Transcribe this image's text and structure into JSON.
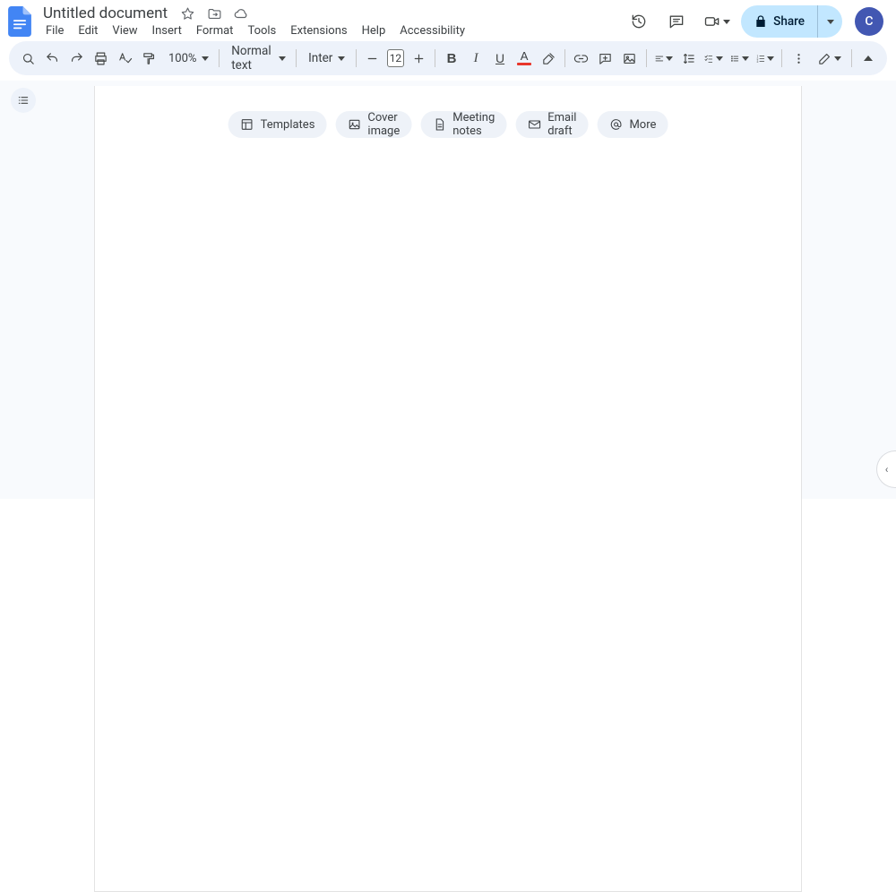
{
  "header": {
    "title": "Untitled document",
    "share_label": "Share",
    "avatar_initial": "C"
  },
  "menu": {
    "items": [
      "File",
      "Edit",
      "View",
      "Insert",
      "Format",
      "Tools",
      "Extensions",
      "Help",
      "Accessibility"
    ]
  },
  "toolbar": {
    "zoom": "100%",
    "style": "Normal text",
    "font": "Inter",
    "font_size": "12"
  },
  "chips": [
    {
      "icon": "templates-icon",
      "label": "Templates"
    },
    {
      "icon": "image-icon",
      "label": "Cover image"
    },
    {
      "icon": "document-icon",
      "label": "Meeting notes"
    },
    {
      "icon": "email-icon",
      "label": "Email draft"
    },
    {
      "icon": "at-icon",
      "label": "More"
    }
  ]
}
